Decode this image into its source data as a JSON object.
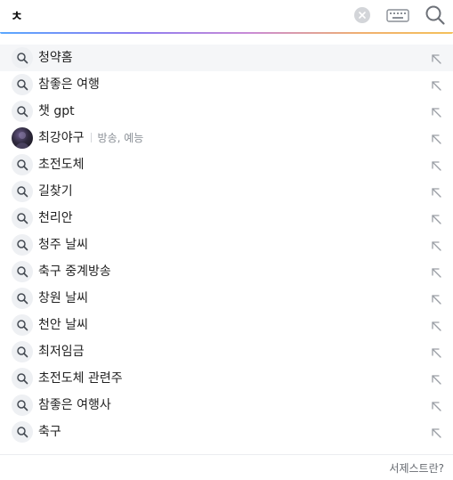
{
  "search": {
    "query": "ㅊ",
    "clear_icon": "clear-x-circle-icon",
    "keyboard_icon": "keyboard-icon",
    "search_icon": "magnifier-icon"
  },
  "suggestions": [
    {
      "text": "청약홈",
      "icon": "search-icon",
      "active": true
    },
    {
      "text": "참좋은 여행",
      "icon": "search-icon"
    },
    {
      "text": "챗 gpt",
      "icon": "search-icon"
    },
    {
      "text": "최강야구",
      "icon": "avatar-thumbnail",
      "category": "방송, 예능"
    },
    {
      "text": "초전도체",
      "icon": "search-icon"
    },
    {
      "text": "길찾기",
      "icon": "search-icon"
    },
    {
      "text": "천리안",
      "icon": "search-icon"
    },
    {
      "text": "청주 날씨",
      "icon": "search-icon"
    },
    {
      "text": "축구 중계방송",
      "icon": "search-icon"
    },
    {
      "text": "창원 날씨",
      "icon": "search-icon"
    },
    {
      "text": "천안 날씨",
      "icon": "search-icon"
    },
    {
      "text": "최저임금",
      "icon": "search-icon"
    },
    {
      "text": "초전도체 관련주",
      "icon": "search-icon"
    },
    {
      "text": "참좋은 여행사",
      "icon": "search-icon"
    },
    {
      "text": "축구",
      "icon": "search-icon"
    }
  ],
  "footer": {
    "link_label": "서제스트란?"
  },
  "colors": {
    "accent_gradient": [
      "#5aa8ff",
      "#8d7cf0",
      "#c98bd6",
      "#f0b06e",
      "#f5c15a"
    ],
    "active_row_bg": "#f5f6f8",
    "text": "#222222",
    "muted": "#8a8f96"
  }
}
